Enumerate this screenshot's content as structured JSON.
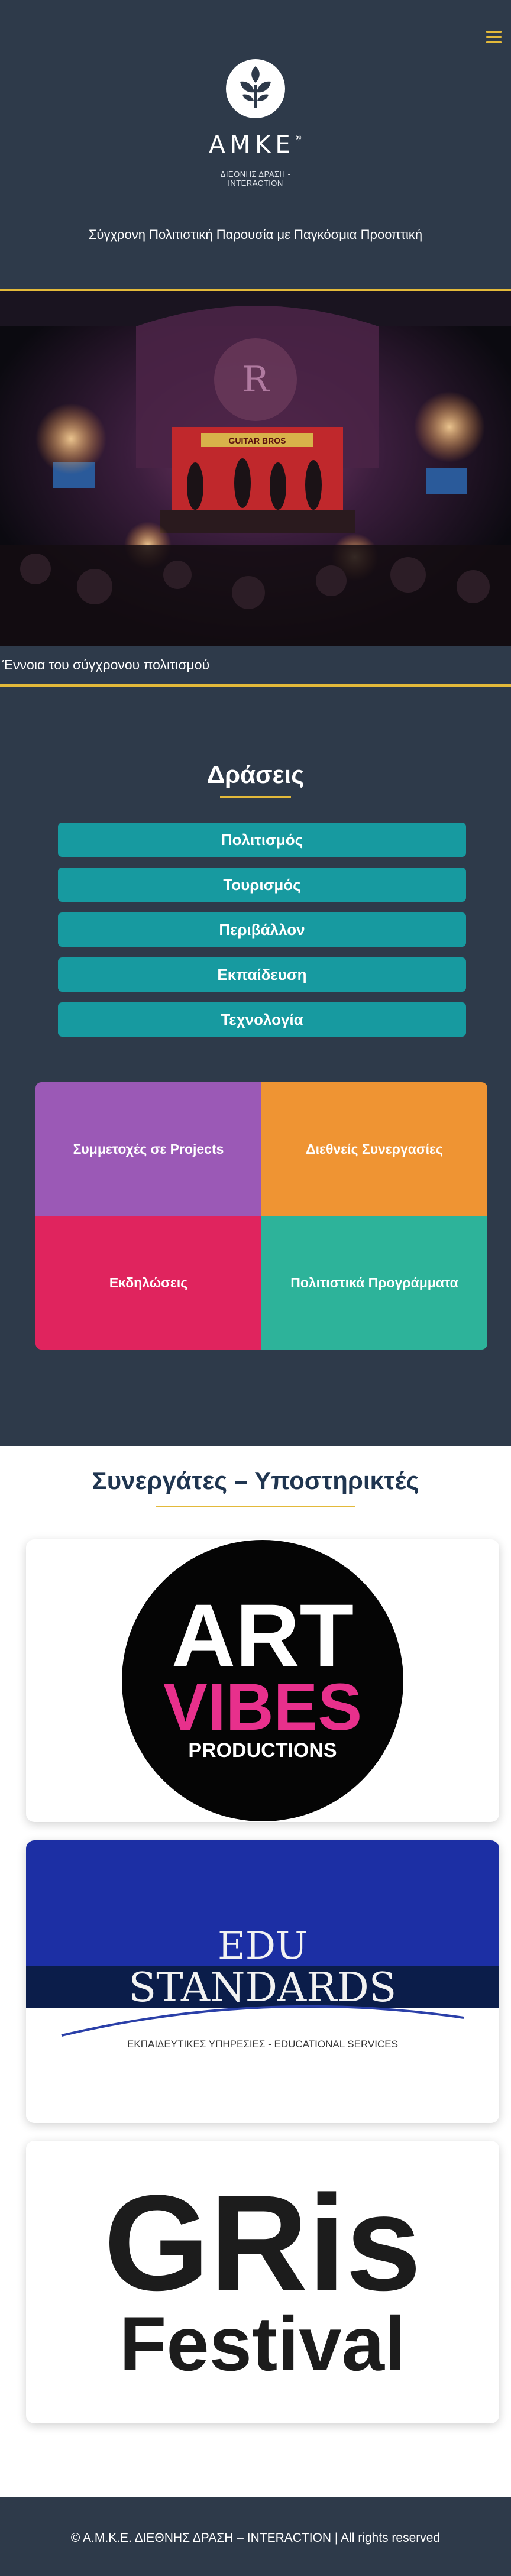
{
  "header": {
    "menu_icon": "hamburger-icon",
    "logo_icon": "leaf-logo-icon",
    "logo_title": "ΑΜΚΕ",
    "logo_registered": "®",
    "logo_subtitle": "ΔΙΕΘΝΗΣ ΔΡΑΣΗ - INTERACTION",
    "tagline": "Σύγχρονη Πολιτιστική Παρουσία με Παγκόσμια Προοπτική",
    "accent_color": "#e3b93a",
    "background_color": "#2e3a4a"
  },
  "hero": {
    "caption": "Έννοια του σύγχρονου πολιτισμού",
    "stage_sign": "GUITAR BROS"
  },
  "actions": {
    "title": "Δράσεις",
    "buttons": [
      {
        "label": "Πολιτισμός"
      },
      {
        "label": "Τουρισμός"
      },
      {
        "label": "Περιβάλλον"
      },
      {
        "label": "Εκπαίδευση"
      },
      {
        "label": "Τεχνολογία"
      }
    ],
    "button_color": "#179aa0",
    "tiles": [
      {
        "label": "Συμμετοχές σε Projects",
        "color": "#9b59b6"
      },
      {
        "label": "Διεθνείς Συνεργασίες",
        "color": "#ef9433"
      },
      {
        "label": "Εκδηλώσεις",
        "color": "#e0245e"
      },
      {
        "label": "Πολιτιστικά Προγράμματα",
        "color": "#2db39a"
      }
    ]
  },
  "partners": {
    "title": "Συνεργάτες – Υποστηρικτές",
    "artvibes": {
      "line1": "ART",
      "line2": "VIBES",
      "line3": "PRODUCTIONS"
    },
    "edustandards": {
      "line1": "EDU",
      "line2": "STANDARDS",
      "line3": "ΕΚΠΑΙΔΕΥΤΙΚΕΣ ΥΠΗΡΕΣΙΕΣ - EDUCATIONAL SERVICES"
    },
    "gris": {
      "line1": "GRis",
      "line2": "Festival"
    }
  },
  "footer": {
    "text": "© Α.Μ.Κ.Ε. ΔΙΕΘΝΗΣ ΔΡΑΣΗ – INTERACTION | All rights reserved"
  }
}
